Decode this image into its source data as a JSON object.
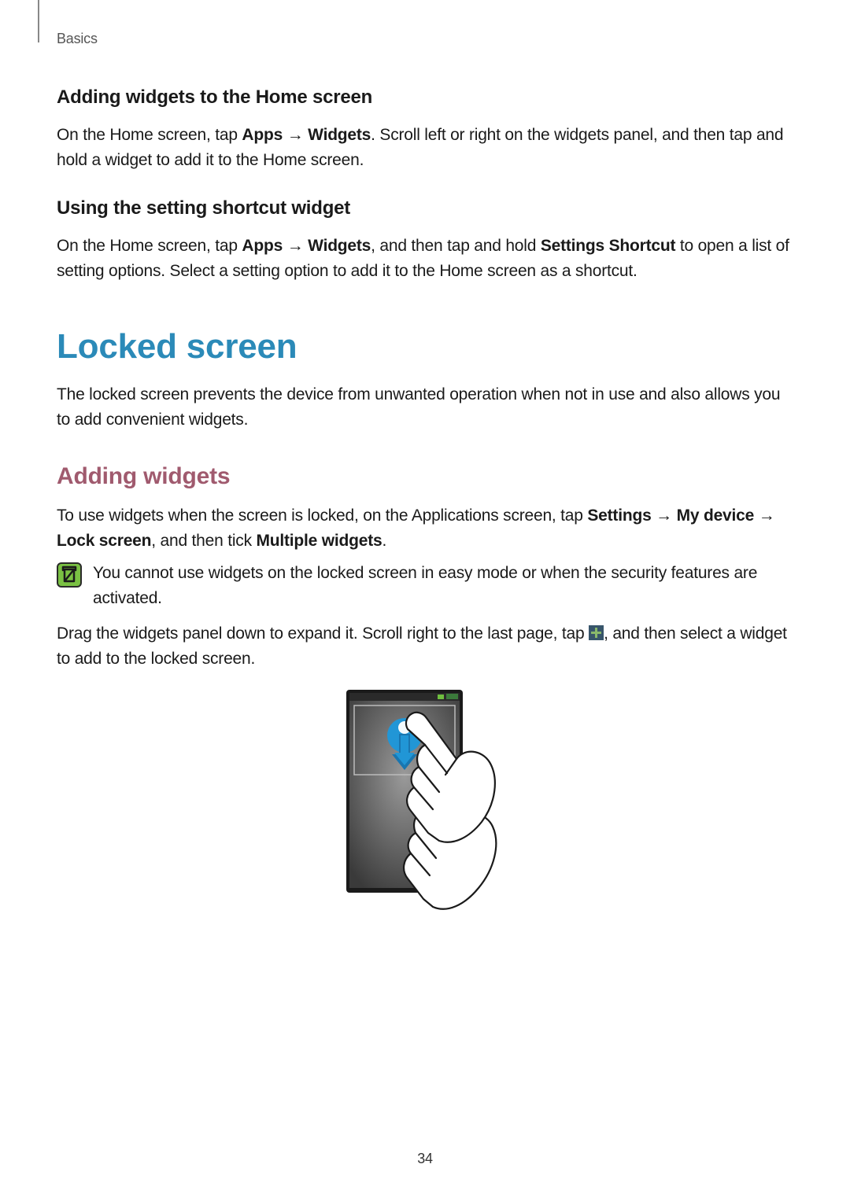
{
  "breadcrumb": "Basics",
  "section1": {
    "heading": "Adding widgets to the Home screen",
    "p_pre": "On the Home screen, tap ",
    "apps": "Apps",
    "arrow": " → ",
    "widgets": "Widgets",
    "p_post": ". Scroll left or right on the widgets panel, and then tap and hold a widget to add it to the Home screen."
  },
  "section2": {
    "heading": "Using the setting shortcut widget",
    "p_pre": "On the Home screen, tap ",
    "apps": "Apps",
    "arrow": " → ",
    "widgets": "Widgets",
    "p_mid": ", and then tap and hold ",
    "shortcut": "Settings Shortcut",
    "p_post": " to open a list of setting options. Select a setting option to add it to the Home screen as a shortcut."
  },
  "main_heading": "Locked screen",
  "main_para": "The locked screen prevents the device from unwanted operation when not in use and also allows you to add convenient widgets.",
  "sub_heading": "Adding widgets",
  "sub_para": {
    "pre": "To use widgets when the screen is locked, on the Applications screen, tap ",
    "settings": "Settings",
    "arrow1": " → ",
    "mydevice": "My device",
    "arrow2": " → ",
    "lockscreen": "Lock screen",
    "mid": ", and then tick ",
    "multiple": "Multiple widgets",
    "post": "."
  },
  "note": "You cannot use widgets on the locked screen in easy mode or when the security features are activated.",
  "drag_para": {
    "pre": "Drag the widgets panel down to expand it. Scroll right to the last page, tap ",
    "post": ", and then select a widget to add to the locked screen."
  },
  "page_number": "34"
}
